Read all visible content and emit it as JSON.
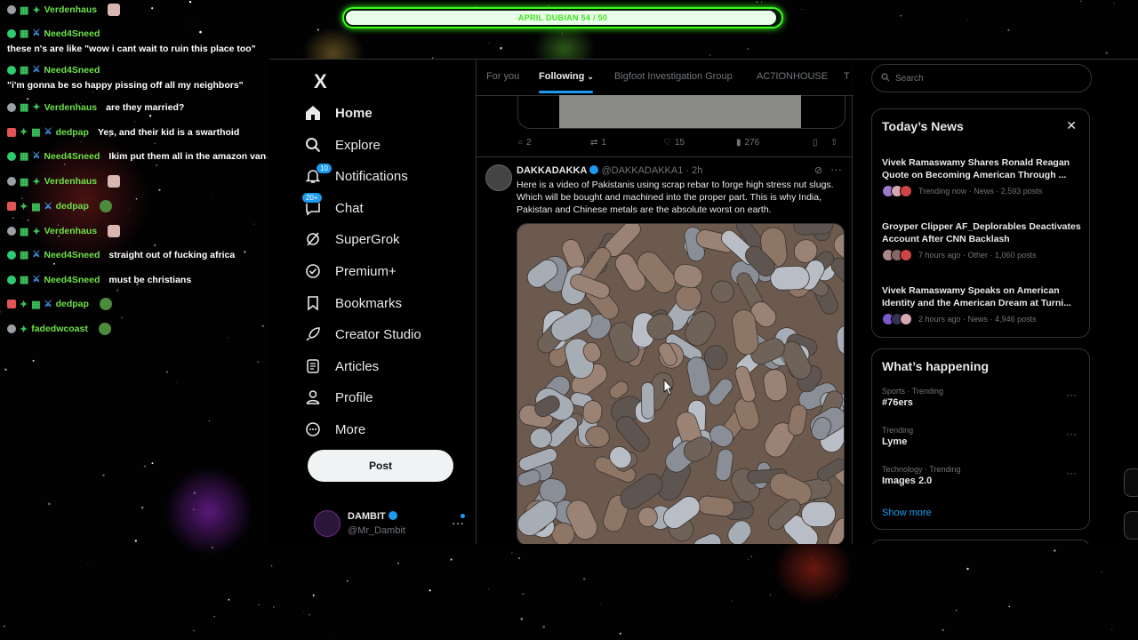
{
  "goal_bar": {
    "label": "APRIL DUBIAN 54 / 50",
    "progress": 1.0,
    "color": "#39ff14"
  },
  "chat": {
    "user_color": "#6ee04a",
    "messages": [
      {
        "user": "Verdenhaus",
        "text": "",
        "badges": [
          "grey-circle",
          "emote",
          "emote-green"
        ],
        "emote": "face"
      },
      {
        "user": "Need4Sneed",
        "text": "these n's are like \"wow i cant wait to ruin this place too\"",
        "badges": [
          "green-circle",
          "emote",
          "sword"
        ],
        "wrap": true
      },
      {
        "user": "Need4Sneed",
        "text": "\"i'm gonna be so happy pissing off all my neighbors\"",
        "badges": [
          "green-circle",
          "emote",
          "sword"
        ],
        "wrap": true
      },
      {
        "user": "Verdenhaus",
        "text": "are they married?",
        "badges": [
          "grey-circle",
          "emote",
          "emote-green"
        ]
      },
      {
        "user": "dedpap",
        "text": "Yes, and their kid is a swarthoid",
        "badges": [
          "red",
          "emote-green",
          "emote",
          "sword"
        ]
      },
      {
        "user": "Need4Sneed",
        "text": "Ikim put them all in the amazon van",
        "badges": [
          "green-circle",
          "emote",
          "sword"
        ]
      },
      {
        "user": "Verdenhaus",
        "text": "",
        "badges": [
          "grey-circle",
          "emote",
          "emote-green"
        ],
        "emote": "face"
      },
      {
        "user": "dedpap",
        "text": "",
        "badges": [
          "red",
          "emote-green",
          "emote",
          "sword"
        ],
        "emote": "frog"
      },
      {
        "user": "Verdenhaus",
        "text": "",
        "badges": [
          "grey-circle",
          "emote",
          "emote-green"
        ],
        "emote": "face"
      },
      {
        "user": "Need4Sneed",
        "text": "straight out of fucking africa",
        "badges": [
          "green-circle",
          "emote",
          "sword"
        ]
      },
      {
        "user": "Need4Sneed",
        "text": "must be christians",
        "badges": [
          "green-circle",
          "emote",
          "sword"
        ]
      },
      {
        "user": "dedpap",
        "text": "",
        "badges": [
          "red",
          "emote-green",
          "emote",
          "sword"
        ],
        "emote": "frog"
      },
      {
        "user": "fadedwcoast",
        "text": "",
        "badges": [
          "grey-circle",
          "emote-green"
        ],
        "emote": "frog"
      }
    ]
  },
  "nav": {
    "logo": "X",
    "items": [
      {
        "label": "Home",
        "icon": "home-icon",
        "active": true
      },
      {
        "label": "Explore",
        "icon": "search-icon"
      },
      {
        "label": "Notifications",
        "icon": "bell-icon",
        "count": "10"
      },
      {
        "label": "Chat",
        "icon": "chat-icon",
        "count": "20+"
      },
      {
        "label": "SuperGrok",
        "icon": "grok-icon"
      },
      {
        "label": "Premium+",
        "icon": "premium-icon"
      },
      {
        "label": "Bookmarks",
        "icon": "bookmark-icon"
      },
      {
        "label": "Creator Studio",
        "icon": "rocket-icon"
      },
      {
        "label": "Articles",
        "icon": "articles-icon"
      },
      {
        "label": "Profile",
        "icon": "person-icon"
      },
      {
        "label": "More",
        "icon": "more-circle-icon"
      }
    ],
    "post_label": "Post",
    "account": {
      "name": "DAMBIT",
      "handle": "@Mr_Dambit",
      "more": "···"
    }
  },
  "tabs": {
    "items": [
      "For you",
      "Following",
      "Bigfoot Investigation Group",
      "AC7IONHOUSE",
      "T"
    ],
    "selected": "Following"
  },
  "prev_tweet_actions": {
    "replies": "2",
    "reposts": "1",
    "likes": "15",
    "views": "276"
  },
  "tweet": {
    "name": "DAKKADAKKA",
    "handle": "@DAKKADAKKA1",
    "time": "· 2h",
    "more": "···",
    "text": "Here is a video of Pakistanis using scrap rebar to forge high stress nut slugs. Which will be bought and machined into the proper part. This is why India, Pakistan and Chinese metals are the absolute worst on earth."
  },
  "sidebar": {
    "search_placeholder": "Search",
    "news": {
      "title": "Today’s News",
      "close": "✕",
      "items": [
        {
          "title": "Vivek Ramaswamy Shares Ronald Reagan Quote on Becoming American Through ...",
          "meta": "Trending now · News · 2,593 posts"
        },
        {
          "title": "Groyper Clipper AF_Deplorables Deactivates Account After CNN Backlash",
          "meta": "7 hours ago · Other · 1,060 posts"
        },
        {
          "title": "Vivek Ramaswamy Speaks on American Identity and the American Dream at Turni...",
          "meta": "2 hours ago · News · 4,946 posts"
        }
      ]
    },
    "happening": {
      "title": "What’s happening",
      "trends": [
        {
          "category": "Sports · Trending",
          "name": "#76ers"
        },
        {
          "category": "Trending",
          "name": "Lyme"
        },
        {
          "category": "Technology · Trending",
          "name": "Images 2.0"
        }
      ],
      "show_more": "Show more"
    }
  }
}
